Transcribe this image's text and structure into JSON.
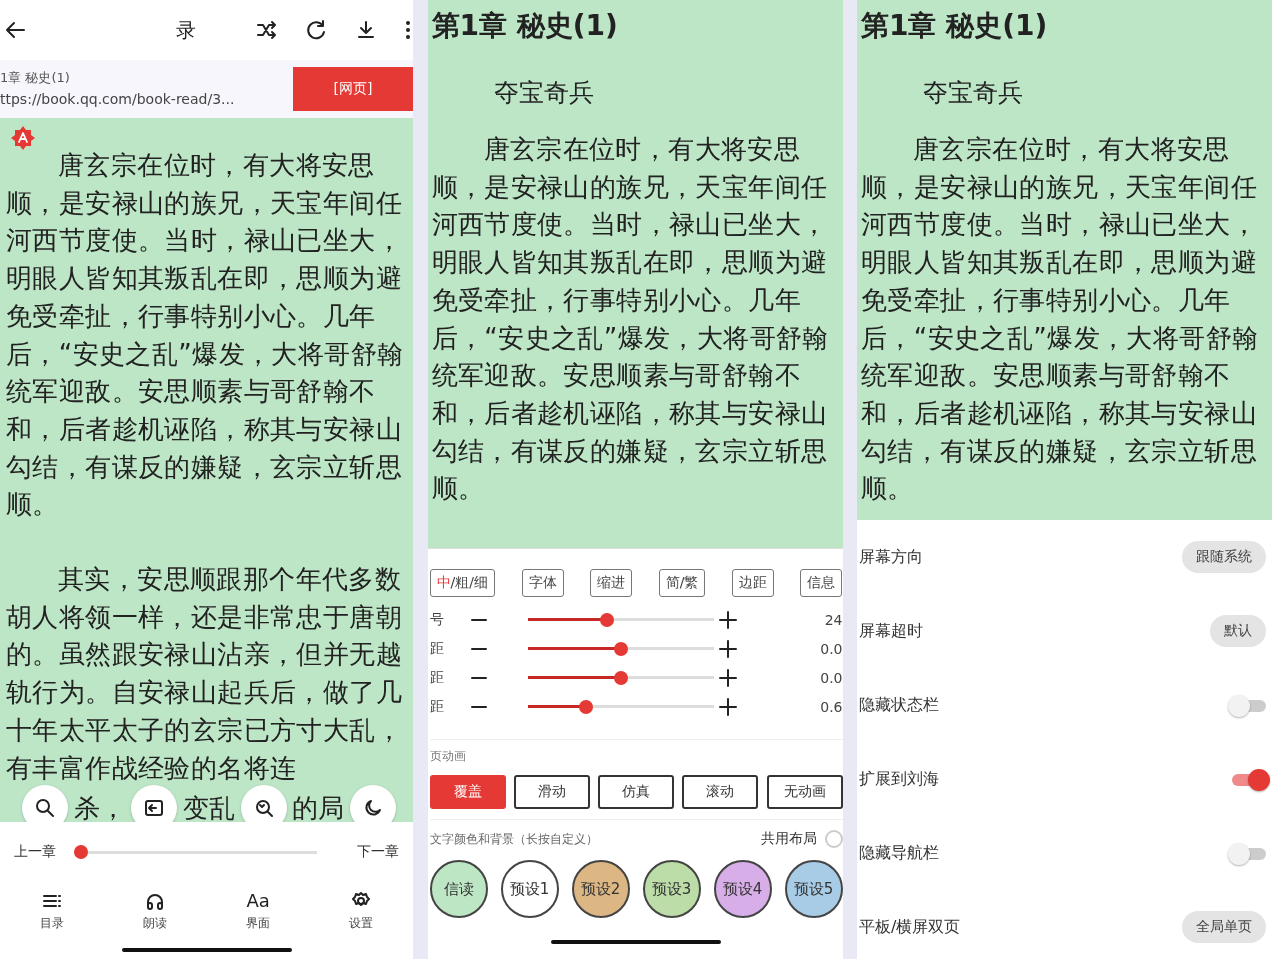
{
  "reader_screen": {
    "title": "录",
    "chapter_title": "1章 秘史(1)",
    "url": "ttps://book.qq.com/book-read/3...",
    "source_button": "[网页]",
    "paragraphs": [
      "唐玄宗在位时，有大将安思顺，是安禄山的族兄，天宝年间任河西节度使。当时，禄山已坐大，明眼人皆知其叛乱在即，思顺为避免受牵扯，行事特别小心。几年后，“安史之乱”爆发，大将哥舒翰统军迎敌。安思顺素与哥舒翰不和，后者趁机诬陷，称其与安禄山勾结，有谋反的嫌疑，玄宗立斩思顺。",
      "其实，安思顺跟那个年代多数胡人将领一样，还是非常忠于唐朝的。虽然跟安禄山沾亲，但并无越轨行为。自安禄山起兵后，做了几十年太平太子的玄宗已方寸大乱，有丰富作战经验的名将连"
    ],
    "covered_line_fragments": [
      "杀，",
      "变乱",
      "的局"
    ],
    "chapter_nav": {
      "prev": "上一章",
      "next": "下一章",
      "level": 0
    },
    "nav_items": [
      {
        "label": "目录"
      },
      {
        "label": "朗读"
      },
      {
        "label": "界面",
        "glyph": "Aa"
      },
      {
        "label": "设置"
      }
    ]
  },
  "layout_screen": {
    "heading": "第1章 秘史(1)",
    "subtitle": "夺宝奇兵",
    "paragraph": "唐玄宗在位时，有大将安思顺，是安禄山的族兄，天宝年间任河西节度使。当时，禄山已坐大，明眼人皆知其叛乱在即，思顺为避免受牵扯，行事特别小心。几年后，“安史之乱”爆发，大将哥舒翰统军迎敌。安思顺素与哥舒翰不和，后者趁机诬陷，称其与安禄山勾结，有谋反的嫌疑，玄宗立斩思顺。",
    "style_options": [
      {
        "accent": "中",
        "label": "/粗/细"
      },
      {
        "label": "字体"
      },
      {
        "label": "缩进"
      },
      {
        "label": "简/繁"
      },
      {
        "label": "边距"
      },
      {
        "label": "信息"
      }
    ],
    "sliders": [
      {
        "label": "号",
        "level": 0.42,
        "value": "24"
      },
      {
        "label": "距",
        "level": 0.5,
        "value": "0.0"
      },
      {
        "label": "距",
        "level": 0.5,
        "value": "0.0"
      },
      {
        "label": "距",
        "level": 0.3,
        "value": "0.6"
      }
    ],
    "page_animation": {
      "label": "页动画",
      "options": [
        {
          "label": "覆盖",
          "selected": true
        },
        {
          "label": "滑动",
          "selected": false
        },
        {
          "label": "仿真",
          "selected": false
        },
        {
          "label": "滚动",
          "selected": false
        },
        {
          "label": "无动画",
          "selected": false
        }
      ]
    },
    "color_themes": {
      "label": "文字颜色和背景（长按自定义）",
      "shared_layout": {
        "label": "共用布局",
        "checked": false
      },
      "presets": [
        {
          "label": "信读",
          "color": "#bde6c4"
        },
        {
          "label": "预设1",
          "color": "#ffffff"
        },
        {
          "label": "预设2",
          "color": "#dcb784"
        },
        {
          "label": "预设3",
          "color": "#bcdca8"
        },
        {
          "label": "预设4",
          "color": "#d8aee8"
        },
        {
          "label": "预设5",
          "color": "#a8cce6"
        }
      ]
    }
  },
  "settings_screen": {
    "heading": "第1章 秘史(1)",
    "subtitle": "夺宝奇兵",
    "paragraph": "唐玄宗在位时，有大将安思顺，是安禄山的族兄，天宝年间任河西节度使。当时，禄山已坐大，明眼人皆知其叛乱在即，思顺为避免受牵扯，行事特别小心。几年后，“安史之乱”爆发，大将哥舒翰统军迎敌。安思顺素与哥舒翰不和，后者趁机诬陷，称其与安禄山勾结，有谋反的嫌疑，玄宗立斩思顺。",
    "settings": [
      {
        "kind": "value",
        "label": "屏幕方向",
        "value": "跟随系统"
      },
      {
        "kind": "value",
        "label": "屏幕超时",
        "value": "默认"
      },
      {
        "kind": "toggle",
        "label": "隐藏状态栏",
        "on": false
      },
      {
        "kind": "toggle",
        "label": "扩展到刘海",
        "on": true
      },
      {
        "kind": "toggle",
        "label": "隐藏导航栏",
        "on": false
      },
      {
        "kind": "value",
        "label": "平板/横屏双页",
        "value": "全局单页"
      }
    ]
  }
}
